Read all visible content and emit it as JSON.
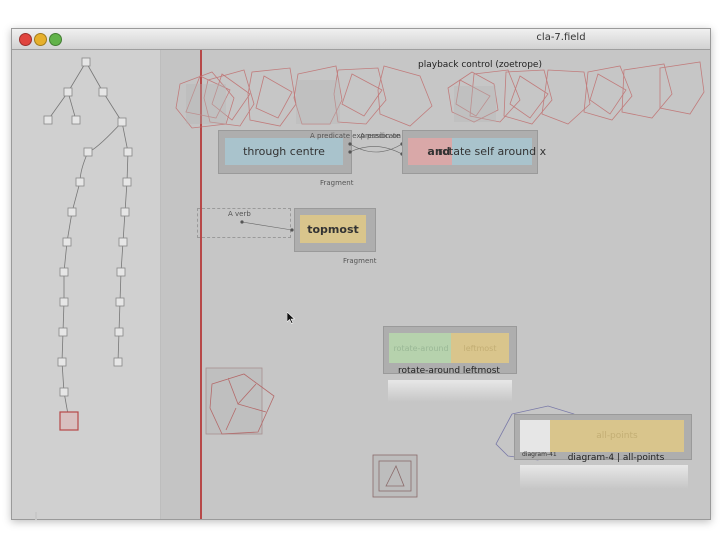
{
  "window": {
    "title": "cla-7.field"
  },
  "playback": {
    "label": "playback control (zoetrope)"
  },
  "nodes": {
    "through_centre": "through centre",
    "and": "and",
    "rotate_self": "rotate self around x",
    "topmost": "topmost",
    "rotate_around_green": "rotate-around",
    "leftmost_tag": "leftmost",
    "rotate_around_leftmost": "rotate-around leftmost",
    "diagram_small": "diagram-41",
    "all_points_tag": "all-points",
    "diagram_all_points": "diagram-4 | all-points"
  },
  "annotations": {
    "predicate1": "A predicate expression on",
    "predicate2": "A predicate expression on",
    "verb": "A verb",
    "fragment1": "Fragment",
    "fragment2": "Fragment"
  },
  "colors": {
    "accent_red": "#b74848",
    "node_blue": "#a9c3cc",
    "node_yellow": "#d9c58c",
    "node_pink": "#d9a8a8",
    "node_green": "#b6d2ad"
  }
}
